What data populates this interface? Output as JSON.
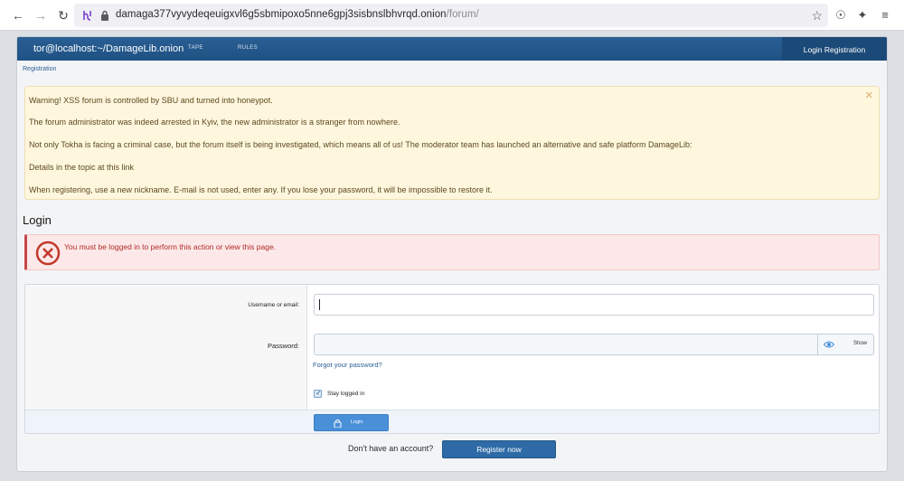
{
  "browser": {
    "url_host": "damaga377vyvydeqeuigxvl6g5sbmipoxo5nne6gpj3sisbnslbhvrqd.onion",
    "url_path": "/forum/"
  },
  "header": {
    "site_title": "tor@localhost:~/DamageLib.onion",
    "nav": [
      "TAPE",
      "RULES"
    ],
    "login_registration": "Login Registration"
  },
  "breadcrumb": "Registration",
  "notice": {
    "lines": [
      "Warning! XSS forum is controlled by SBU and turned into honeypot.",
      "The forum administrator was indeed arrested in Kyiv, the new administrator is a stranger from nowhere.",
      "Not only Tokha is facing a criminal case, but the forum itself is being investigated, which means all of us! The moderator team has launched an alternative and safe platform DamageLib:",
      "Details in the topic at this link",
      "When registering, use a new nickname. E-mail is not used, enter any. If you lose your password, it will be impossible to restore it."
    ]
  },
  "login": {
    "heading": "Login",
    "error": "You must be logged in to perform this action or view this page.",
    "username_label": "Username or email:",
    "username_value": "",
    "password_label": "Password:",
    "password_value": "",
    "show_label": "Show",
    "forgot_password": "Forgot your password?",
    "stay_logged_in": "Stay logged in",
    "stay_logged_in_checked": true,
    "login_button": "Login"
  },
  "account": {
    "prompt": "Don't have an account?",
    "register_button": "Register now"
  },
  "colors": {
    "header": "#1f5184",
    "notice_bg": "#fff6de",
    "error_bg": "#fce8e8",
    "error_accent": "#c84848",
    "button_primary": "#2d6aa6"
  }
}
